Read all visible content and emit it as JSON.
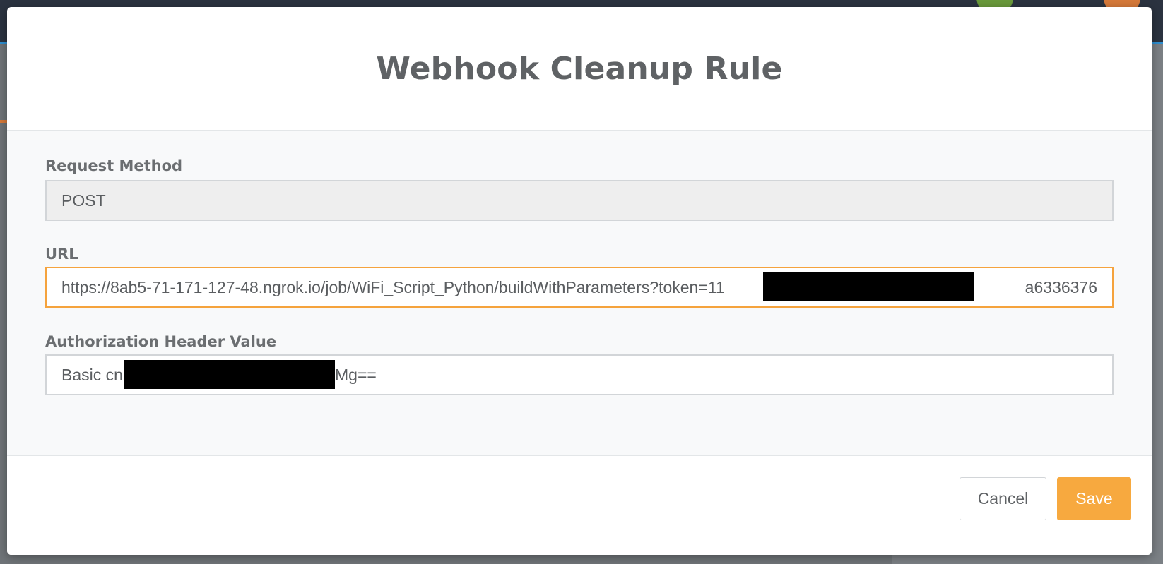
{
  "modal": {
    "title": "Webhook Cleanup Rule"
  },
  "fields": {
    "request_method": {
      "label": "Request Method",
      "value": "POST"
    },
    "url": {
      "label": "URL",
      "value": "https://8ab5-71-171-127-48.ngrok.io/job/WiFi_Script_Python/buildWithParameters?token=11",
      "value_suffix": "a6336376"
    },
    "authorization": {
      "label": "Authorization Header Value",
      "value": "Basic cn",
      "value_suffix": "Mg=="
    }
  },
  "footer": {
    "cancel_label": "Cancel",
    "save_label": "Save"
  },
  "colors": {
    "accent": "#f7a93f",
    "focus_border": "#f5a33d",
    "title_text": "#5f6265",
    "redaction": "#000000"
  }
}
